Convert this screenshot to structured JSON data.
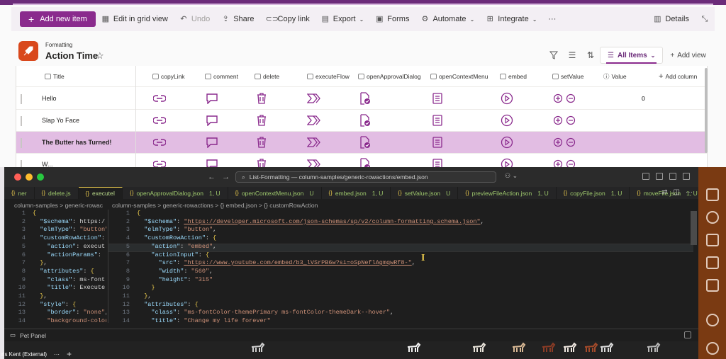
{
  "commandbar": {
    "new_item": "Add new item",
    "items": [
      {
        "label": "Edit in grid view",
        "icon": "grid-icon",
        "disabled": false
      },
      {
        "label": "Undo",
        "icon": "undo-icon",
        "disabled": true
      },
      {
        "label": "Share",
        "icon": "share-icon",
        "disabled": false
      },
      {
        "label": "Copy link",
        "icon": "link-icon",
        "disabled": false
      },
      {
        "label": "Export",
        "icon": "export-icon",
        "disabled": false,
        "chevron": true
      },
      {
        "label": "Forms",
        "icon": "forms-icon",
        "disabled": false
      },
      {
        "label": "Automate",
        "icon": "automate-icon",
        "disabled": false,
        "chevron": true
      },
      {
        "label": "Integrate",
        "icon": "integrate-icon",
        "disabled": false,
        "chevron": true
      }
    ],
    "more": "···",
    "details": "Details"
  },
  "list": {
    "subtitle": "Formatting",
    "title": "Action Time",
    "view_name": "All Items",
    "add_view": "Add view"
  },
  "grid": {
    "columns": [
      "Title",
      "copyLink",
      "comment",
      "delete",
      "executeFlow",
      "openApprovalDialog",
      "openContextMenu",
      "embed",
      "setValue",
      "Value",
      "Add column"
    ],
    "rows": [
      {
        "title": "Hello",
        "value": "0",
        "selected": false
      },
      {
        "title": "Slap Yo Face",
        "value": "",
        "selected": false
      },
      {
        "title": "The Butter has Turned!",
        "value": "",
        "selected": true
      },
      {
        "title": "W...",
        "value": "",
        "selected": false
      }
    ]
  },
  "vscode": {
    "command_center": "List-Formatting — column-samples/generic-rowactions/embed.json",
    "tabs": [
      {
        "label": "ner",
        "status": "",
        "active": false
      },
      {
        "label": "delete.js",
        "status": "",
        "active": false
      },
      {
        "label": "executeI",
        "status": "",
        "active": true
      },
      {
        "label": "openApprovalDialog.json",
        "status": "1, U",
        "active": false
      },
      {
        "label": "openContextMenu.json",
        "status": "U",
        "active": false
      },
      {
        "label": "embed.json",
        "status": "1, U",
        "active": false
      },
      {
        "label": "setValue.json",
        "status": "U",
        "active": false
      },
      {
        "label": "previewFileAction.json",
        "status": "1, U",
        "active": false
      },
      {
        "label": "copyFile.json",
        "status": "1, U",
        "active": false
      },
      {
        "label": "moveFile.json",
        "status": "1, U",
        "active": false
      }
    ],
    "breadcrumb_left": "column-samples > generic-rowac",
    "breadcrumb_right": "column-samples > generic-rowactions > {} embed.json > {} customRowAction",
    "left_lines": [
      {
        "n": "1",
        "t": "{"
      },
      {
        "n": "2",
        "t": "  \"$schema\": \"https:/"
      },
      {
        "n": "3",
        "t": "  \"elmType\": \"button\""
      },
      {
        "n": "4",
        "t": "  \"customRowAction\": -"
      },
      {
        "n": "5",
        "t": "    \"action\": \"execut"
      },
      {
        "n": "6",
        "t": "    \"actionParams\": \""
      },
      {
        "n": "7",
        "t": "  },"
      },
      {
        "n": "8",
        "t": "  \"attributes\": {"
      },
      {
        "n": "9",
        "t": "    \"class\": \"ms-font"
      },
      {
        "n": "10",
        "t": "    \"title\": \"Execute"
      },
      {
        "n": "11",
        "t": "  },"
      },
      {
        "n": "12",
        "t": "  \"style\": {"
      },
      {
        "n": "13",
        "t": "    \"border\": \"none\","
      },
      {
        "n": "14",
        "t": "    \"background-color\""
      }
    ],
    "right_lines": [
      {
        "n": "1",
        "t": "{"
      },
      {
        "n": "2",
        "t": "  \"$schema\": \"https://developer.microsoft.com/json-schemas/sp/v2/column-formatting.schema.json\","
      },
      {
        "n": "3",
        "t": "  \"elmType\": \"button\","
      },
      {
        "n": "4",
        "t": "  \"customRowAction\": {"
      },
      {
        "n": "5",
        "t": "    \"action\": \"embed\","
      },
      {
        "n": "6",
        "t": "    \"actionInput\": {"
      },
      {
        "n": "7",
        "t": "      \"src\": \"https://www.youtube.com/embed/b3_lVSrPB6w?si=oSpNeflAgmqwRf8-\","
      },
      {
        "n": "8",
        "t": "      \"width\": \"560\","
      },
      {
        "n": "9",
        "t": "      \"height\": \"315\""
      },
      {
        "n": "10",
        "t": "    }"
      },
      {
        "n": "11",
        "t": "  },"
      },
      {
        "n": "12",
        "t": "  \"attributes\": {"
      },
      {
        "n": "13",
        "t": "    \"class\": \"ms-fontColor-themePrimary ms-fontColor-themeDark--hover\","
      },
      {
        "n": "14",
        "t": "    \"title\": \"Change my life forever\""
      }
    ],
    "panel": "Pet Panel"
  },
  "meeting": {
    "participant": "ris Kent (External)",
    "more": "···",
    "add": "+"
  },
  "colors": {
    "brand": "#8a2a8d",
    "selected_row": "#e2bde3",
    "vscode_bg": "#1e1e1e",
    "sidebar": "#7a3a12"
  }
}
